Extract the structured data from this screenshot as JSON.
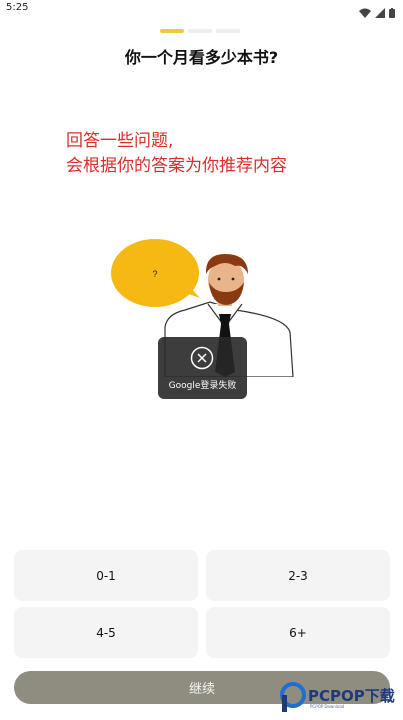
{
  "status_bar": {
    "time": "5:25"
  },
  "progress": {
    "total_steps": 3,
    "current_step": 1
  },
  "question": {
    "title": "你一个月看多少本书?"
  },
  "note": {
    "line1": "回答一些问题,",
    "line2": "会根据你的答案为你推荐内容",
    "color": "#d9302a"
  },
  "illustration": {
    "speech_text": "?"
  },
  "toast": {
    "icon": "close-circle-icon",
    "message": "Google登录失败"
  },
  "options": [
    {
      "label": "0-1"
    },
    {
      "label": "2-3"
    },
    {
      "label": "4-5"
    },
    {
      "label": "6+"
    }
  ],
  "continue_button": {
    "label": "继续"
  },
  "watermark": {
    "brand": "PCPOP下载",
    "sub": "PCPOP Download"
  },
  "colors": {
    "accent": "#f1c93c",
    "button": "#8f8c80",
    "option_bg": "#f4f4f4"
  }
}
